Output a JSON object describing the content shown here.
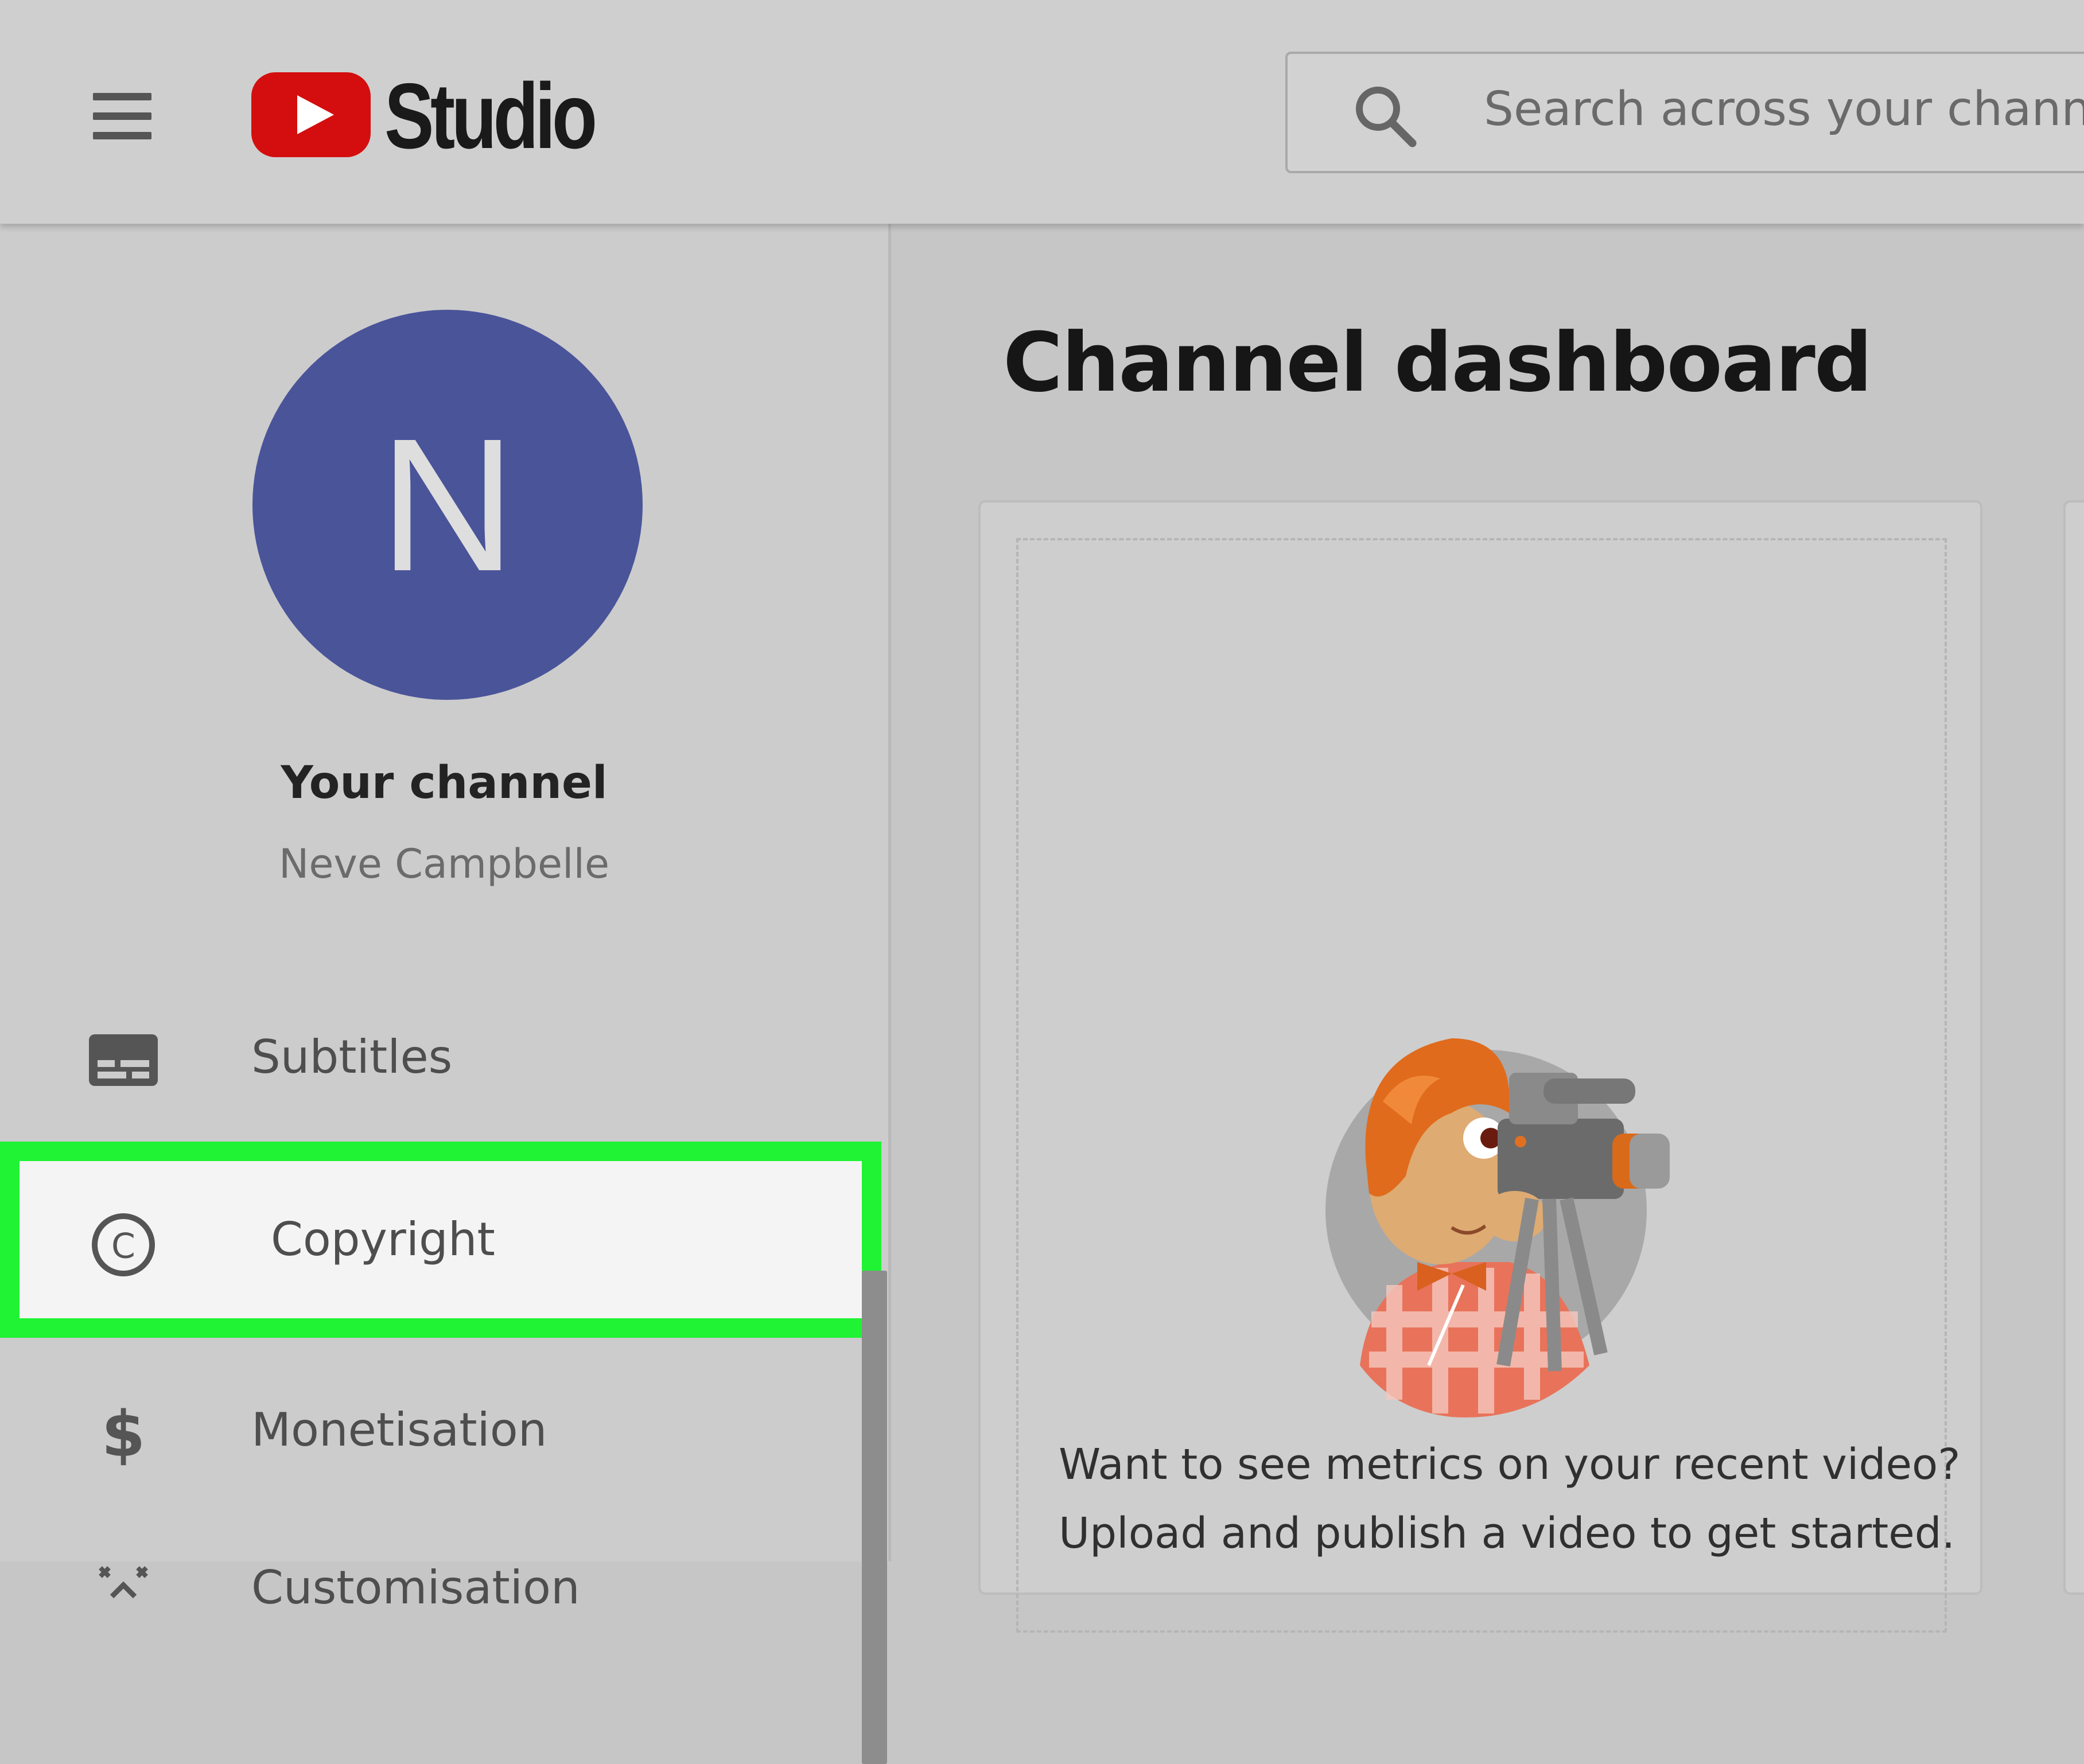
{
  "header": {
    "logo_text": "Studio",
    "search_placeholder": "Search across your channel"
  },
  "sidebar": {
    "avatar_letter": "N",
    "channel_title": "Your channel",
    "channel_name": "Neve Campbelle",
    "items": [
      {
        "label": "Subtitles",
        "icon": "subtitles-icon"
      },
      {
        "label": "Copyright",
        "icon": "copyright-icon",
        "highlighted": true
      },
      {
        "label": "Monetisation",
        "icon": "dollar-icon"
      },
      {
        "label": "Customisation",
        "icon": "customisation-icon"
      }
    ]
  },
  "main": {
    "title": "Channel dashboard",
    "card": {
      "line1": "Want to see metrics on your recent video?",
      "line2": "Upload and publish a video to get started."
    }
  },
  "colors": {
    "youtube_red": "#d40e0e",
    "avatar": "#4a5499",
    "highlight_border": "#1ff334"
  }
}
